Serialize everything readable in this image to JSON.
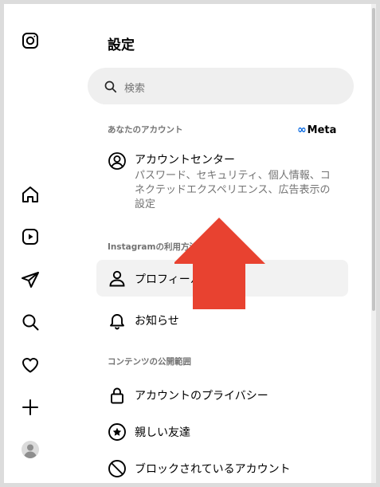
{
  "page_title": "設定",
  "search": {
    "placeholder": "検索"
  },
  "sections": {
    "account": {
      "heading": "あなたのアカウント",
      "meta_logo": "Meta",
      "account_center": {
        "label": "アカウントセンター",
        "description": "パスワード、セキュリティ、個人情報、コネクテッドエクスペリエンス、広告表示の設定"
      }
    },
    "usage": {
      "heading": "Instagramの利用方法",
      "items": [
        {
          "label": "プロフィール",
          "icon": "profile-icon",
          "active": true
        },
        {
          "label": "お知らせ",
          "icon": "bell-icon",
          "active": false
        }
      ]
    },
    "visibility": {
      "heading": "コンテンツの公開範囲",
      "items": [
        {
          "label": "アカウントのプライバシー",
          "icon": "lock-icon"
        },
        {
          "label": "親しい友達",
          "icon": "star-icon"
        },
        {
          "label": "ブロックされているアカウント",
          "icon": "block-icon"
        }
      ]
    }
  },
  "nav_icons": [
    "instagram-icon",
    "home-icon",
    "reels-icon",
    "messages-icon",
    "search-icon",
    "heart-icon",
    "create-icon",
    "avatar"
  ],
  "colors": {
    "annotation_arrow": "#e84230",
    "meta_blue": "#0064e0",
    "active_bg": "#f2f2f2"
  }
}
